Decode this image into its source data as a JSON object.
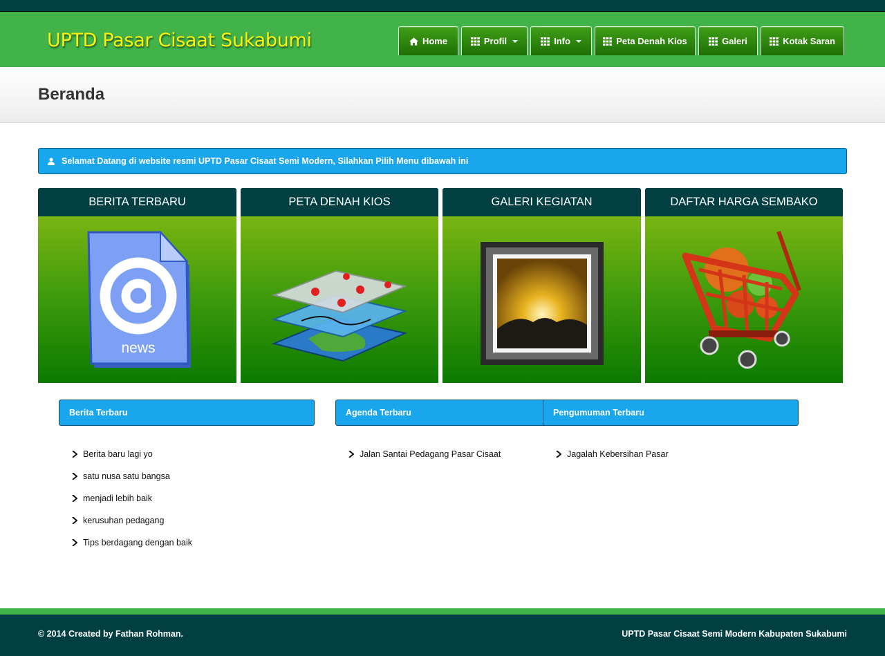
{
  "brand": "UPTD Pasar Cisaat Sukabumi",
  "nav": [
    {
      "label": "Home",
      "icon": "home-icon"
    },
    {
      "label": "Profil",
      "icon": "grid-icon",
      "dropdown": true
    },
    {
      "label": "Info",
      "icon": "grid-icon",
      "dropdown": true
    },
    {
      "label": "Peta Denah Kios",
      "icon": "grid-icon"
    },
    {
      "label": "Galeri",
      "icon": "grid-icon"
    },
    {
      "label": "Kotak Saran",
      "icon": "grid-icon"
    }
  ],
  "page_title": "Beranda",
  "welcome": {
    "icon": "user-icon",
    "text": "Selamat Datang di website resmi UPTD Pasar Cisaat Semi Modern, Silahkan Pilih Menu dibawah ini"
  },
  "cards": [
    {
      "title": "BERITA TERBARU",
      "icon": "news-document-icon",
      "icon_text": "news"
    },
    {
      "title": "PETA DENAH KIOS",
      "icon": "layered-map-icon"
    },
    {
      "title": "GALERI KEGIATAN",
      "icon": "picture-frame-icon"
    },
    {
      "title": "DAFTAR HARGA SEMBAKO",
      "icon": "shopping-cart-icon"
    }
  ],
  "sections": [
    {
      "title": "Berita Terbaru",
      "items": [
        "Berita baru lagi yo",
        "satu nusa satu bangsa",
        "menjadi lebih baik",
        "kerusuhan pedagang",
        "Tips berdagang dengan baik"
      ]
    },
    {
      "title": "Agenda Terbaru",
      "items": [
        "Jalan Santai Pedagang Pasar Cisaat"
      ]
    },
    {
      "title": "Pengumuman Terbaru",
      "items": [
        "Jagalah Kebersihan Pasar"
      ]
    }
  ],
  "footer": {
    "left": "© 2014 Created by Fathan Rohman.",
    "right": "UPTD Pasar Cisaat Semi Modern Kabupaten Sukabumi"
  },
  "colors": {
    "dark_teal": "#013f42",
    "green": "#41b349",
    "blue": "#1aa6ec",
    "brand_yellow": "#fbf30f"
  }
}
